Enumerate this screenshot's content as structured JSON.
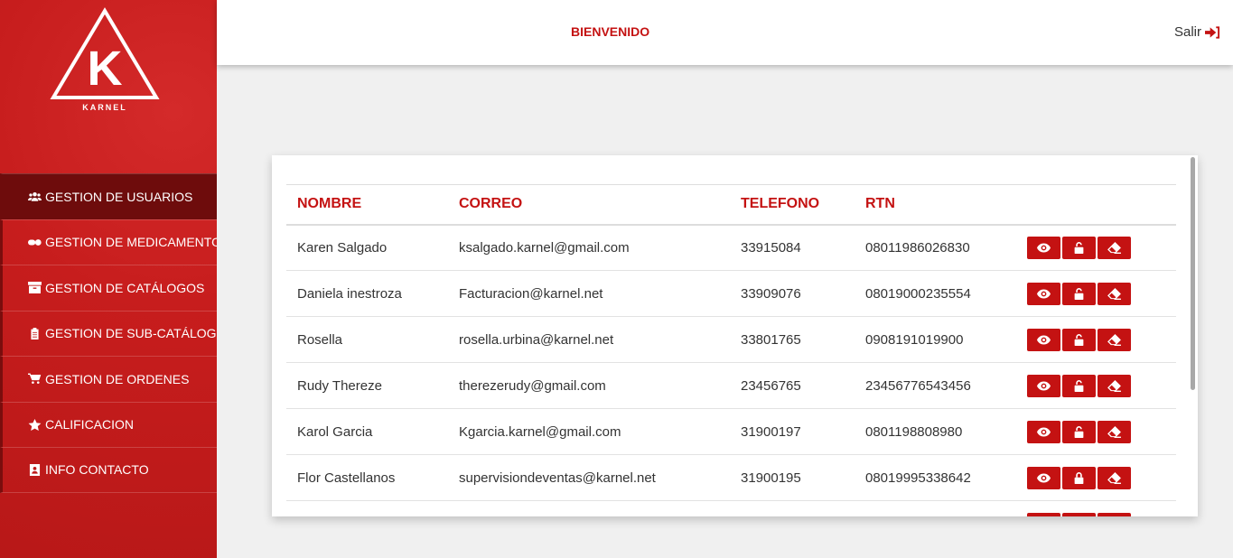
{
  "brand": {
    "logo_letter": "K",
    "logo_text": "KARNEL"
  },
  "header": {
    "welcome": "BIENVENIDO",
    "logout_label": "Salir"
  },
  "sidebar": {
    "items": [
      {
        "label": "GESTION DE USUARIOS",
        "icon": "users-icon",
        "active": true
      },
      {
        "label": "GESTION DE MEDICAMENTOS",
        "icon": "pills-icon"
      },
      {
        "label": "GESTION DE CATÁLOGOS",
        "icon": "archive-icon"
      },
      {
        "label": "GESTION DE SUB-CATÁLOGOS",
        "icon": "clipboard-icon"
      },
      {
        "label": "GESTION DE ORDENES",
        "icon": "cart-icon"
      },
      {
        "label": "CALIFICACION",
        "icon": "star-icon"
      },
      {
        "label": "INFO CONTACTO",
        "icon": "contact-card-icon"
      }
    ]
  },
  "table": {
    "headers": [
      "NOMBRE",
      "CORREO",
      "TELEFONO",
      "RTN"
    ],
    "rows": [
      {
        "nombre": "Karen Salgado",
        "correo": "ksalgado.karnel@gmail.com",
        "telefono": "33915084",
        "rtn": "08011986026830",
        "lock": "unlocked"
      },
      {
        "nombre": "Daniela inestroza",
        "correo": "Facturacion@karnel.net",
        "telefono": "33909076",
        "rtn": "08019000235554",
        "lock": "unlocked"
      },
      {
        "nombre": "Rosella",
        "correo": "rosella.urbina@karnel.net",
        "telefono": "33801765",
        "rtn": "0908191019900",
        "lock": "unlocked"
      },
      {
        "nombre": "Rudy Thereze",
        "correo": "therezerudy@gmail.com",
        "telefono": "23456765",
        "rtn": "23456776543456",
        "lock": "unlocked"
      },
      {
        "nombre": "Karol Garcia",
        "correo": "Kgarcia.karnel@gmail.com",
        "telefono": "31900197",
        "rtn": "0801198808980",
        "lock": "unlocked"
      },
      {
        "nombre": "Flor Castellanos",
        "correo": "supervisiondeventas@karnel.net",
        "telefono": "31900195",
        "rtn": "08019995338642",
        "lock": "locked"
      },
      {
        "nombre": "",
        "correo": "",
        "telefono": "",
        "rtn": "",
        "lock": "unlocked"
      }
    ]
  },
  "colors": {
    "accent": "#c41212",
    "sidebar": "#c71d1d",
    "active_item": "#6e0c0c"
  }
}
